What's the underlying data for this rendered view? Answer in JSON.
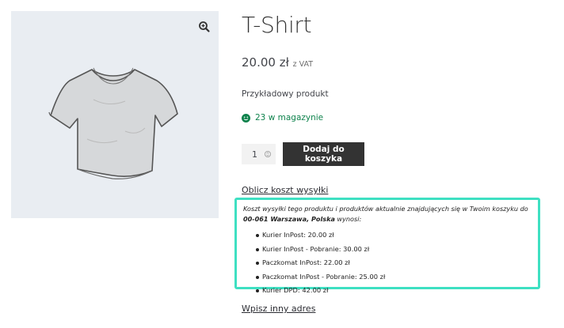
{
  "product": {
    "title": "T-Shirt",
    "price": "20.00 zł",
    "price_suffix": "z VAT",
    "description": "Przykładowy produkt",
    "stock": "23 w magazynie",
    "quantity": "1",
    "add_to_cart_label": "Dodaj do koszyka"
  },
  "shipping": {
    "calc_link": "Oblicz koszt wysyłki",
    "intro_start": "Koszt wysyłki tego produktu i produktów aktualnie znajdujących się w Twoim koszyku do",
    "intro_address": "00-061 Warszawa, Polska",
    "intro_end": "wynosi:",
    "options": [
      "Kurier InPost: 20.00 zł",
      "Kurier InPost - Pobranie: 30.00 zł",
      "Paczkomat InPost: 22.00 zł",
      "Paczkomat InPost - Pobranie: 25.00 zł",
      "Kurier DPD: 42.00 zł"
    ],
    "other_address_link": "Wpisz inny adres"
  },
  "colors": {
    "highlight_border": "#3ee0c2",
    "stock_green": "#0f834d",
    "button_bg": "#333333"
  },
  "icons": {
    "zoom": "zoom-in-icon",
    "stock": "smiley-icon",
    "spinner": "quantity-spinner-icon"
  }
}
